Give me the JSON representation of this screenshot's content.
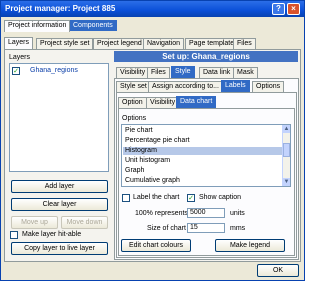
{
  "window": {
    "title": "Project manager: Project 885",
    "help_label": "?",
    "close_label": "×"
  },
  "top_tabs": [
    "Project information",
    "Components"
  ],
  "main_tabs": [
    "Layers",
    "Project style set",
    "Project legend",
    "Navigation",
    "Page template",
    "Files"
  ],
  "layers": {
    "heading": "Layers",
    "items": [
      "Ghana_regions"
    ]
  },
  "left_buttons": {
    "add": "Add layer",
    "clear": "Clear layer",
    "move_up": "Move up",
    "move_down": "Move down",
    "hit_able": "Make layer hit-able",
    "copy": "Copy layer to live layer"
  },
  "setup": {
    "title": "Set up: Ghana_regions",
    "tabs1": [
      "Visibility",
      "Files",
      "Style",
      "Data link",
      "Mask"
    ],
    "tabs2": [
      "Style set",
      "Assign according to...",
      "Labels",
      "Options"
    ],
    "tabs3": [
      "Option",
      "Visibility",
      "Data chart"
    ]
  },
  "options": {
    "heading": "Options",
    "items": [
      "Pie chart",
      "Percentage pie chart",
      "Histogram",
      "Unit histogram",
      "Graph",
      "Cumulative graph"
    ],
    "selected": "Histogram"
  },
  "chart_opts": {
    "label_chart": "Label the chart",
    "show_caption": "Show caption",
    "represents_label": "100% represents",
    "represents_value": "5000",
    "represents_unit": "units",
    "size_label": "Size of chart",
    "size_value": "15",
    "size_unit": "mms",
    "edit_colours": "Edit chart colours",
    "make_legend": "Make legend"
  },
  "ok_label": "OK"
}
